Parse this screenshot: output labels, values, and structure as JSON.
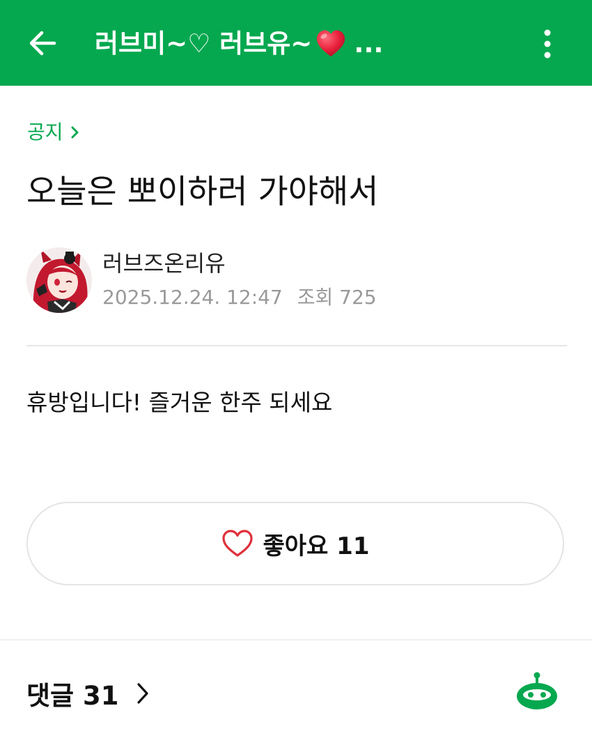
{
  "header": {
    "title_part1": "러브미~♡ 러브유~",
    "title_ellipsis": "..."
  },
  "post": {
    "category": "공지",
    "title": "오늘은 뽀이하러 가야해서",
    "author": "러브즈온리유",
    "date": "2025.12.24. 12:47",
    "views_label": "조회 725",
    "body": "휴방입니다! 즐거운 한주 되세요"
  },
  "like": {
    "label": "좋아요 11"
  },
  "comments": {
    "label": "댓글 31"
  },
  "colors": {
    "brand_green": "#05a84f",
    "heart_red": "#e0303b"
  }
}
